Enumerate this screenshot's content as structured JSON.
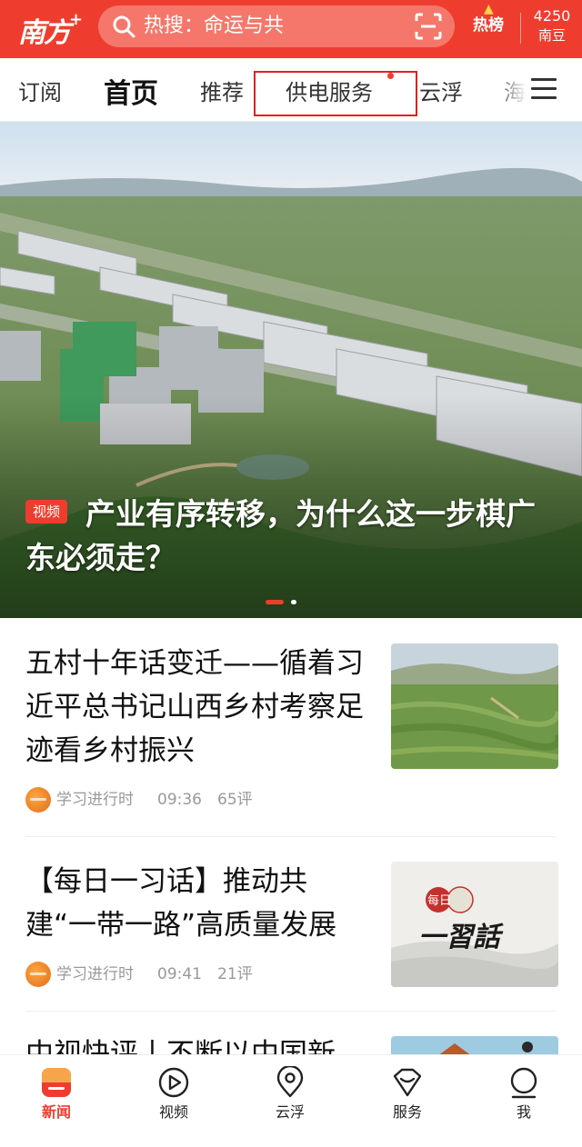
{
  "header": {
    "logo_text": "南方",
    "logo_plus": "+",
    "search_label": "热搜：命运与共",
    "hot_label": "热榜",
    "points_value": "4250",
    "points_label": "南豆",
    "brand_color": "#ee3d2f"
  },
  "tabs": [
    {
      "label": "订阅"
    },
    {
      "label": "首页",
      "active": true
    },
    {
      "label": "推荐"
    },
    {
      "label": "供电服务",
      "highlighted": true,
      "has_dot": true
    },
    {
      "label": "云浮"
    },
    {
      "label": "海"
    }
  ],
  "hero": {
    "badge": "视频",
    "title": "产业有序转移，为什么这一步棋广东必须走？",
    "slide_index": 1,
    "slide_count": 2
  },
  "articles": [
    {
      "title": "五村十年话变迁——循着习近平总书记山西乡村考察足迹看乡村振兴",
      "source": "学习进行时",
      "time": "09:36",
      "comments": "65评"
    },
    {
      "title": "【每日一习话】推动共建“一带一路”高质量发展",
      "source": "学习进行时",
      "time": "09:41",
      "comments": "21评",
      "thumb_text_small": "每日",
      "thumb_text_big": "一習話"
    },
    {
      "title": "中视快评丨不断以中国新"
    }
  ],
  "bottom_nav": [
    {
      "label": "新闻",
      "icon": "news-icon",
      "active": true
    },
    {
      "label": "视频",
      "icon": "video-icon"
    },
    {
      "label": "云浮",
      "icon": "location-icon"
    },
    {
      "label": "服务",
      "icon": "service-icon"
    },
    {
      "label": "我",
      "icon": "profile-icon"
    }
  ]
}
